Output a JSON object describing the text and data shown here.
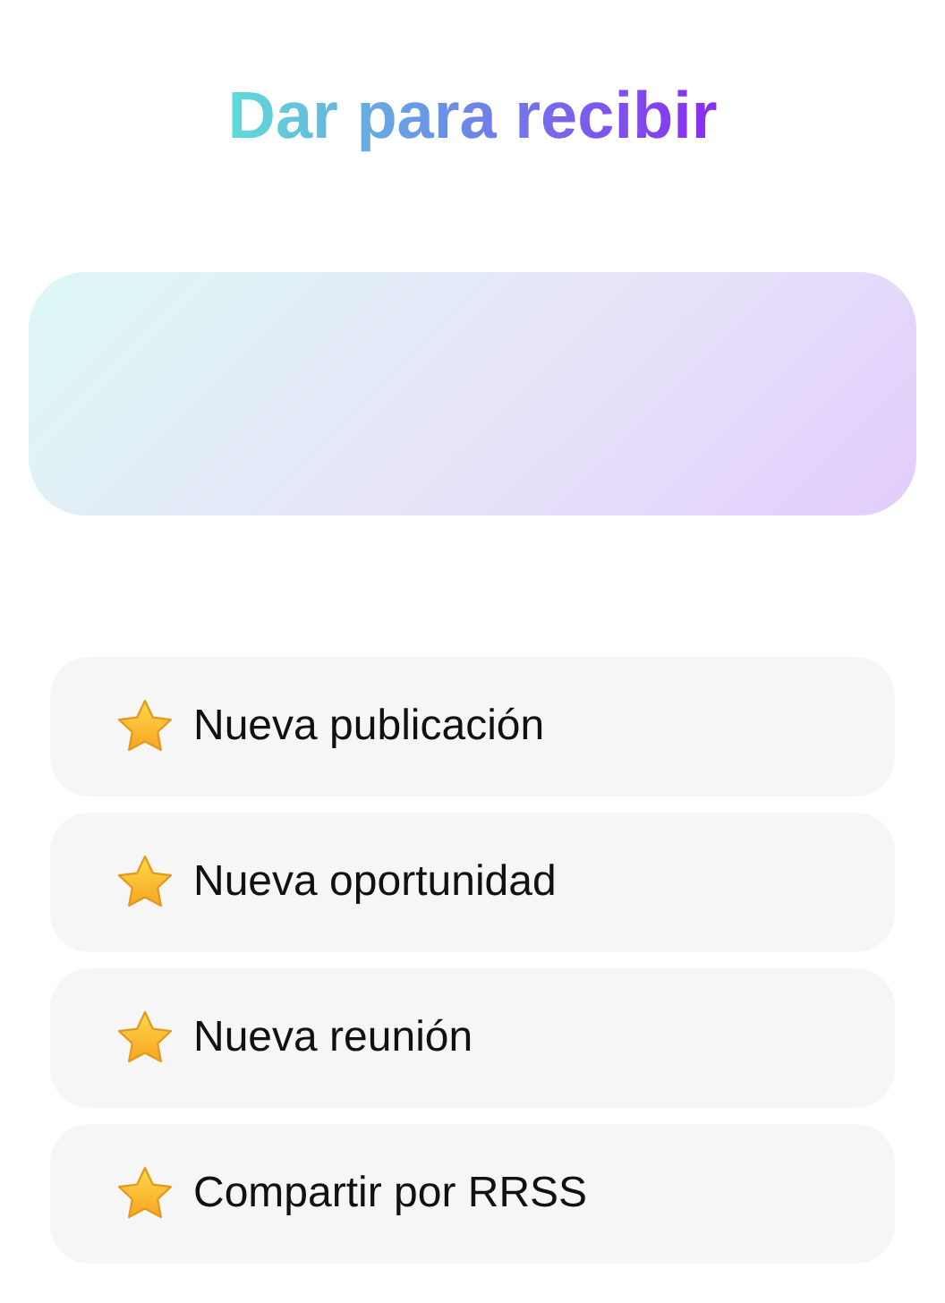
{
  "title": "Dar para recibir",
  "actions": [
    {
      "label": "Nueva publicación"
    },
    {
      "label": "Nueva oportunidad"
    },
    {
      "label": "Nueva reunión"
    },
    {
      "label": "Compartir por RRSS"
    }
  ]
}
